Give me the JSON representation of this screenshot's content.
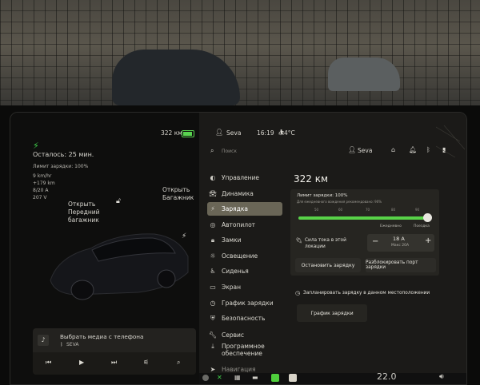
{
  "status": {
    "range_top": "322 км",
    "user": "Seva",
    "time": "16:19",
    "temp": "4°C"
  },
  "left": {
    "charge_time": "Осталось: 25 мин.",
    "limit": "Лимит зарядки: 100%",
    "stats": [
      "9 km/hr",
      "+179 km",
      "8/20 A",
      "207 V"
    ],
    "front_trunk": "Открыть\nПередний\nбагажник",
    "trunk": "Открыть\nБагажник"
  },
  "search": {
    "placeholder": "Поиск"
  },
  "profile": {
    "name": "Seva"
  },
  "menu": [
    {
      "icon": "toggle-icon",
      "label": "Управление"
    },
    {
      "icon": "car-icon",
      "label": "Динамика"
    },
    {
      "icon": "bolt-icon",
      "label": "Зарядка",
      "active": true
    },
    {
      "icon": "steering-icon",
      "label": "Автопилот"
    },
    {
      "icon": "lock-icon",
      "label": "Замки"
    },
    {
      "icon": "sun-icon",
      "label": "Освещение"
    },
    {
      "icon": "seat-icon",
      "label": "Сиденья"
    },
    {
      "icon": "screen-icon",
      "label": "Экран"
    },
    {
      "icon": "clock-icon",
      "label": "График зарядки"
    },
    {
      "icon": "shield-icon",
      "label": "Безопасность"
    },
    {
      "icon": "wrench-icon",
      "label": "Сервис"
    },
    {
      "icon": "download-icon",
      "label": "Программное\nобеспечение"
    },
    {
      "icon": "navigation-icon",
      "label": "Навигация"
    }
  ],
  "charging": {
    "range": "322 км",
    "limit_label": "Лимит зарядки: 100%",
    "limit_hint": "Для ежедневного вождения рекомендовано: 90%",
    "limit_value": 100,
    "ticks": [
      "50",
      "60",
      "70",
      "80",
      "90"
    ],
    "daily": "Ежедневно",
    "trip": "Поездка",
    "current_label": "Сила тока в этой\nлокации",
    "current_value": "18 A",
    "current_max": "Макс 20A",
    "stop_button": "Остановить зарядку",
    "unlock_button": "Разблокировать порт зарядки",
    "schedule_label": "Запланировать зарядку в данном местоположении",
    "schedule_button": "График зарядки"
  },
  "media": {
    "title": "Выбрать медиа с телефона",
    "source": "SEVA"
  },
  "dock": {
    "temperature": "22.0"
  },
  "colors": {
    "accent": "#58d248",
    "active_menu": "#6a6657"
  }
}
